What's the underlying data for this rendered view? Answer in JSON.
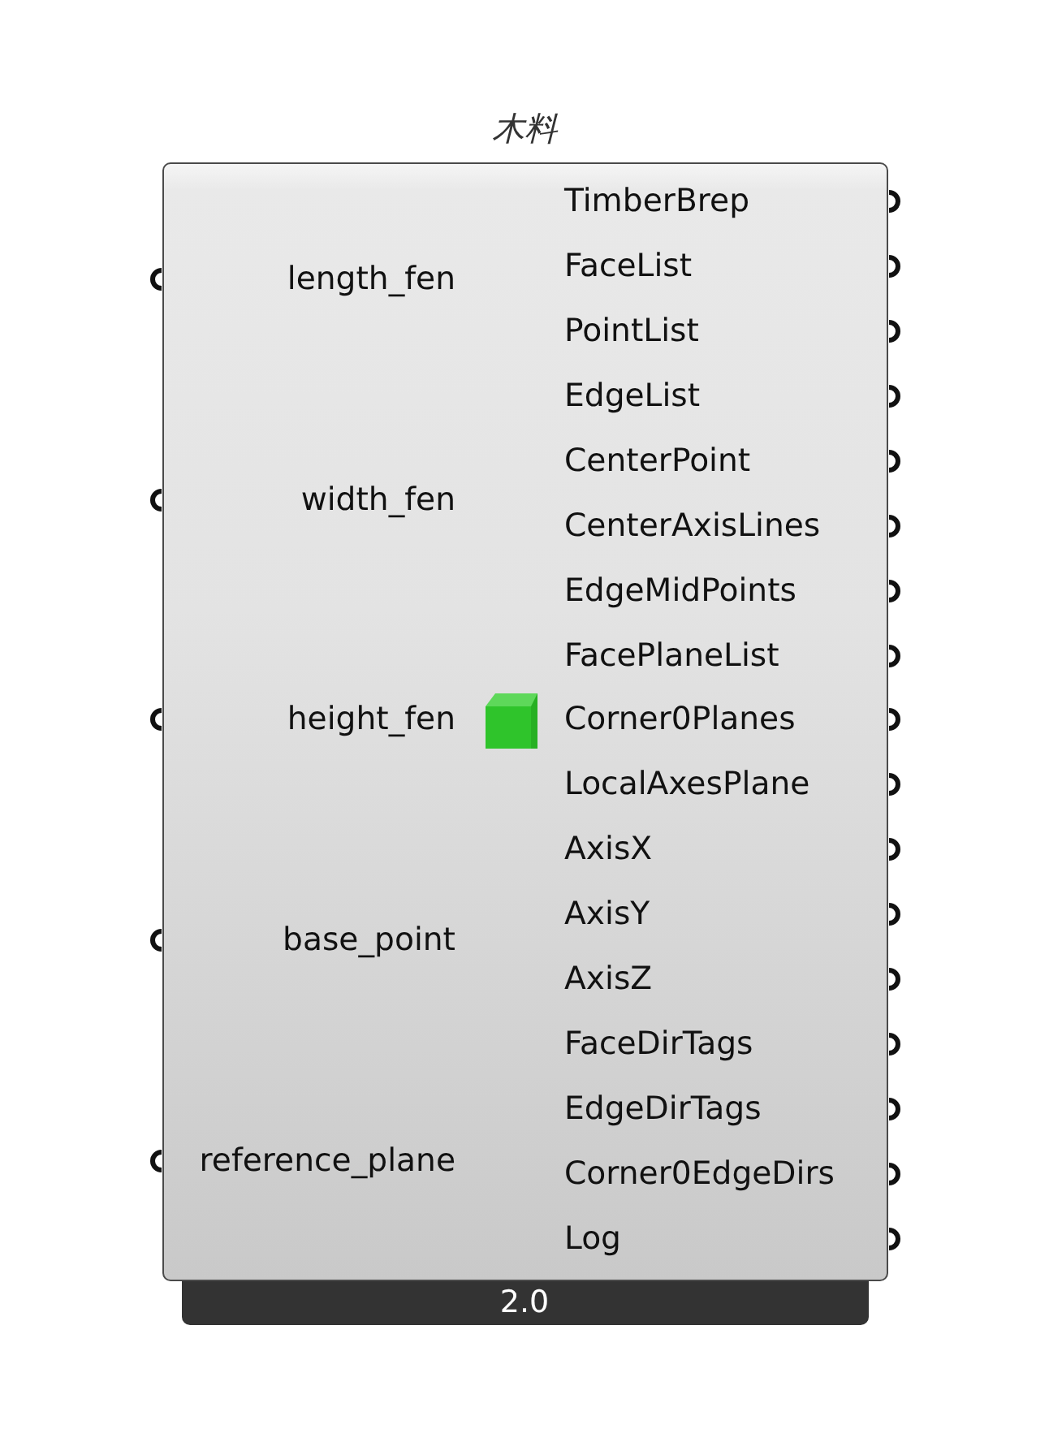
{
  "component": {
    "title": "木料",
    "inputs": [
      "length_fen",
      "width_fen",
      "height_fen",
      "base_point",
      "reference_plane"
    ],
    "outputs": [
      "TimberBrep",
      "FaceList",
      "PointList",
      "EdgeList",
      "CenterPoint",
      "CenterAxisLines",
      "EdgeMidPoints",
      "FacePlaneList",
      "Corner0Planes",
      "LocalAxesPlane",
      "AxisX",
      "AxisY",
      "AxisZ",
      "FaceDirTags",
      "EdgeDirTags",
      "Corner0EdgeDirs",
      "Log"
    ],
    "version": "2.0"
  }
}
